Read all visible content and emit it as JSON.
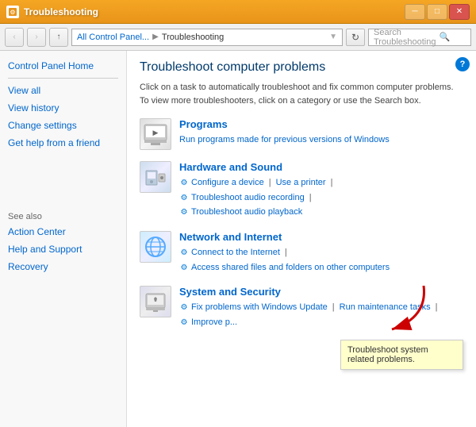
{
  "titleBar": {
    "title": "Troubleshooting",
    "icon": "⚙",
    "minBtn": "─",
    "maxBtn": "□",
    "closeBtn": "✕"
  },
  "addressBar": {
    "backBtn": "‹",
    "forwardBtn": "›",
    "upBtn": "↑",
    "pathParts": [
      "All Control Panel...",
      "Troubleshooting"
    ],
    "dropdownBtn": "▼",
    "refreshBtn": "↻",
    "searchPlaceholder": "Search Troubleshooting",
    "searchIcon": "🔍"
  },
  "sidebar": {
    "homeLink": "Control Panel Home",
    "viewAllLink": "View all",
    "viewHistoryLink": "View history",
    "changeSettingsLink": "Change settings",
    "getHelpLink": "Get help from a friend",
    "seeAlsoLabel": "See also",
    "actionCenterLink": "Action Center",
    "helpSupportLink": "Help and Support",
    "recoveryLink": "Recovery"
  },
  "content": {
    "title": "Troubleshoot computer problems",
    "description": "Click on a task to automatically troubleshoot and fix common computer problems. To view more troubleshooters, click on a category or use the Search box.",
    "categories": [
      {
        "name": "programs",
        "title": "Programs",
        "subtitle": "Run programs made for previous versions of Windows",
        "links": []
      },
      {
        "name": "hardware",
        "title": "Hardware and Sound",
        "links": [
          "Configure a device",
          "Use a printer",
          "Troubleshoot audio recording",
          "Troubleshoot audio playback"
        ]
      },
      {
        "name": "network",
        "title": "Network and Internet",
        "links": [
          "Connect to the Internet",
          "Access shared files and folders on other computers"
        ]
      },
      {
        "name": "security",
        "title": "System and Security",
        "links": [
          "Fix problems with Windows Update",
          "Run maintenance tasks",
          "Improve performance"
        ]
      }
    ],
    "tooltip": "Troubleshoot system related problems.",
    "helpIcon": "?"
  }
}
